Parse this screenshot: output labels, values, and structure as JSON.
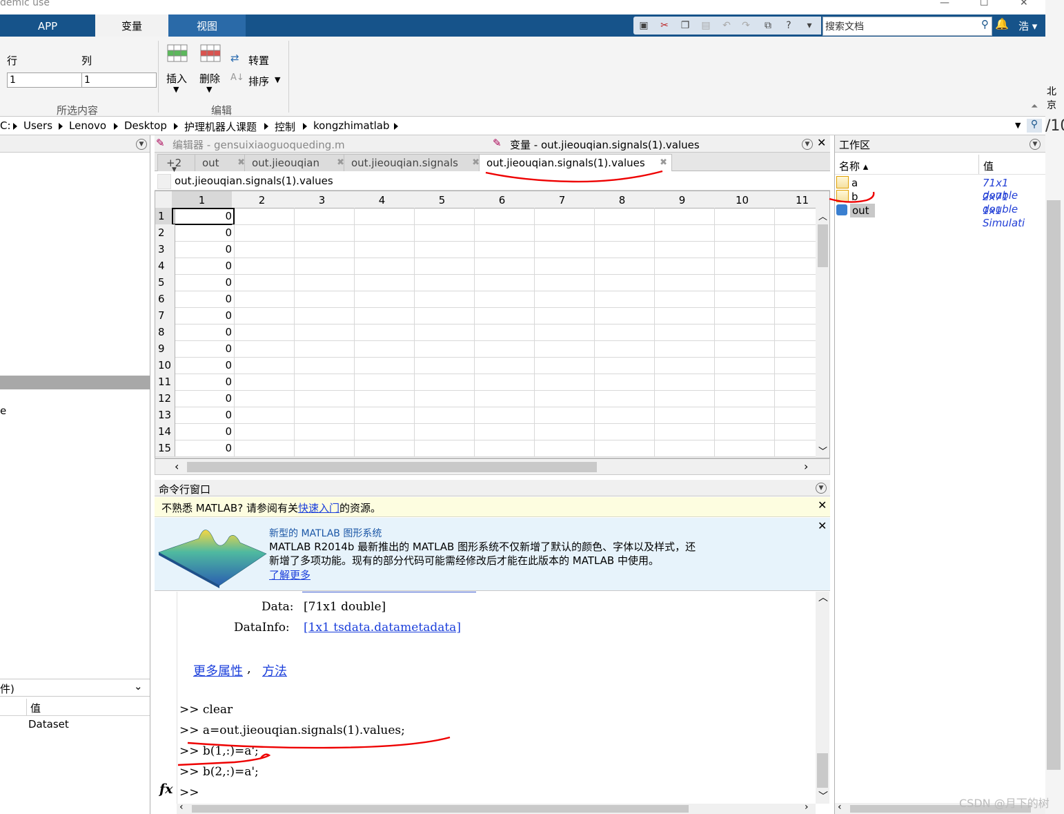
{
  "window": {
    "title_fragment": "demic use"
  },
  "ribbon_tabs": [
    "APP",
    "变量",
    "视图"
  ],
  "search": {
    "placeholder": "搜索文档"
  },
  "user": {
    "name": "浩"
  },
  "ribbon": {
    "row_label": "行",
    "col_label": "列",
    "row_value": "1",
    "col_value": "1",
    "selection_group": "所选内容",
    "insert_label": "插入",
    "delete_label": "删除",
    "transpose_label": "转置",
    "sort_label": "排序",
    "edit_group": "编辑"
  },
  "breadcrumb": [
    "C:",
    "Users",
    "Lenovo",
    "Desktop",
    "护理机器人课题",
    "控制",
    "kongzhimatlab"
  ],
  "editor_header": {
    "editor_title": "编辑器 - gensuixiaoguoqueding.m",
    "variable_title": "变量 - out.jieouqian.signals(1).values"
  },
  "doc_tabs": {
    "overflow": "+2",
    "tabs": [
      "out",
      "out.jieouqian",
      "out.jieouqian.signals",
      "out.jieouqian.signals(1).values"
    ]
  },
  "var_path": "out.jieouqian.signals(1).values",
  "grid": {
    "columns": [
      "1",
      "2",
      "3",
      "4",
      "5",
      "6",
      "7",
      "8",
      "9",
      "10",
      "11"
    ],
    "rows": [
      "1",
      "2",
      "3",
      "4",
      "5",
      "6",
      "7",
      "8",
      "9",
      "10",
      "11",
      "12",
      "13",
      "14",
      "15"
    ],
    "values": [
      "0",
      "0",
      "0",
      "0",
      "0",
      "0",
      "0",
      "0",
      "0",
      "0",
      "0",
      "0",
      "0",
      "0",
      "0"
    ]
  },
  "workspace": {
    "title": "工作区",
    "col_name": "名称 ▴",
    "col_value": "值",
    "vars": [
      {
        "name": "a",
        "value": "71x1 double"
      },
      {
        "name": "b",
        "value": "2x71 double"
      },
      {
        "name": "out",
        "value": "1x1 Simulati"
      }
    ]
  },
  "left_panel": {
    "fragment_e": "e",
    "details_header": "件)",
    "col_value": "值",
    "dataset": "Dataset"
  },
  "command_window": {
    "title": "命令行窗口",
    "notice_prefix": "不熟悉 MATLAB? 请参阅有关",
    "notice_link": "快速入门",
    "notice_suffix": "的资源。",
    "graphics_title": "新型的 MATLAB 图形系统",
    "graphics_line1": "MATLAB R2014b 最新推出的 MATLAB 图形系统不仅新增了默认的颜色、字体以及样式，还",
    "graphics_line2": "新增了多项功能。现有的部分代码可能需经修改后才能在此版本的 MATLAB 中使用。",
    "graphics_link": "了解更多",
    "data_label": "Data:",
    "data_value": "[71x1 double]",
    "datainfo_label": "DataInfo:",
    "datainfo_value": "[1x1 tsdata.datametadata]",
    "more_props": "更多属性",
    "comma": ",",
    "methods": "方法",
    "lines": [
      ">> clear",
      ">> a=out.jieouqian.signals(1).values;",
      ">> b(1,:)=a';",
      ">> b(2,:)=a';",
      ">>"
    ],
    "fx": "fx"
  },
  "right_edge": {
    "frag1": "北京",
    "frag2": "/10"
  },
  "watermark": "CSDN @月下的树"
}
